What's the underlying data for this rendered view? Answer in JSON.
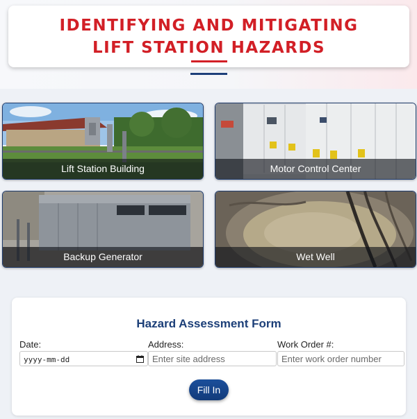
{
  "header": {
    "title_line1": "IDENTIFYING AND MITIGATING",
    "title_line2": "LIFT STATION HAZARDS"
  },
  "gallery": [
    {
      "label": "Lift Station Building"
    },
    {
      "label": "Motor Control Center"
    },
    {
      "label": "Backup Generator"
    },
    {
      "label": "Wet Well"
    }
  ],
  "form": {
    "title": "Hazard Assessment Form",
    "date_label": "Date:",
    "date_value": "yyyy-mm-dd",
    "address_label": "Address:",
    "address_placeholder": "Enter site address",
    "work_order_label": "Work Order #:",
    "work_order_placeholder": "Enter work order number",
    "submit_label": "Fill In"
  },
  "colors": {
    "title_red": "#d21f26",
    "accent_blue": "#1c3f78"
  }
}
